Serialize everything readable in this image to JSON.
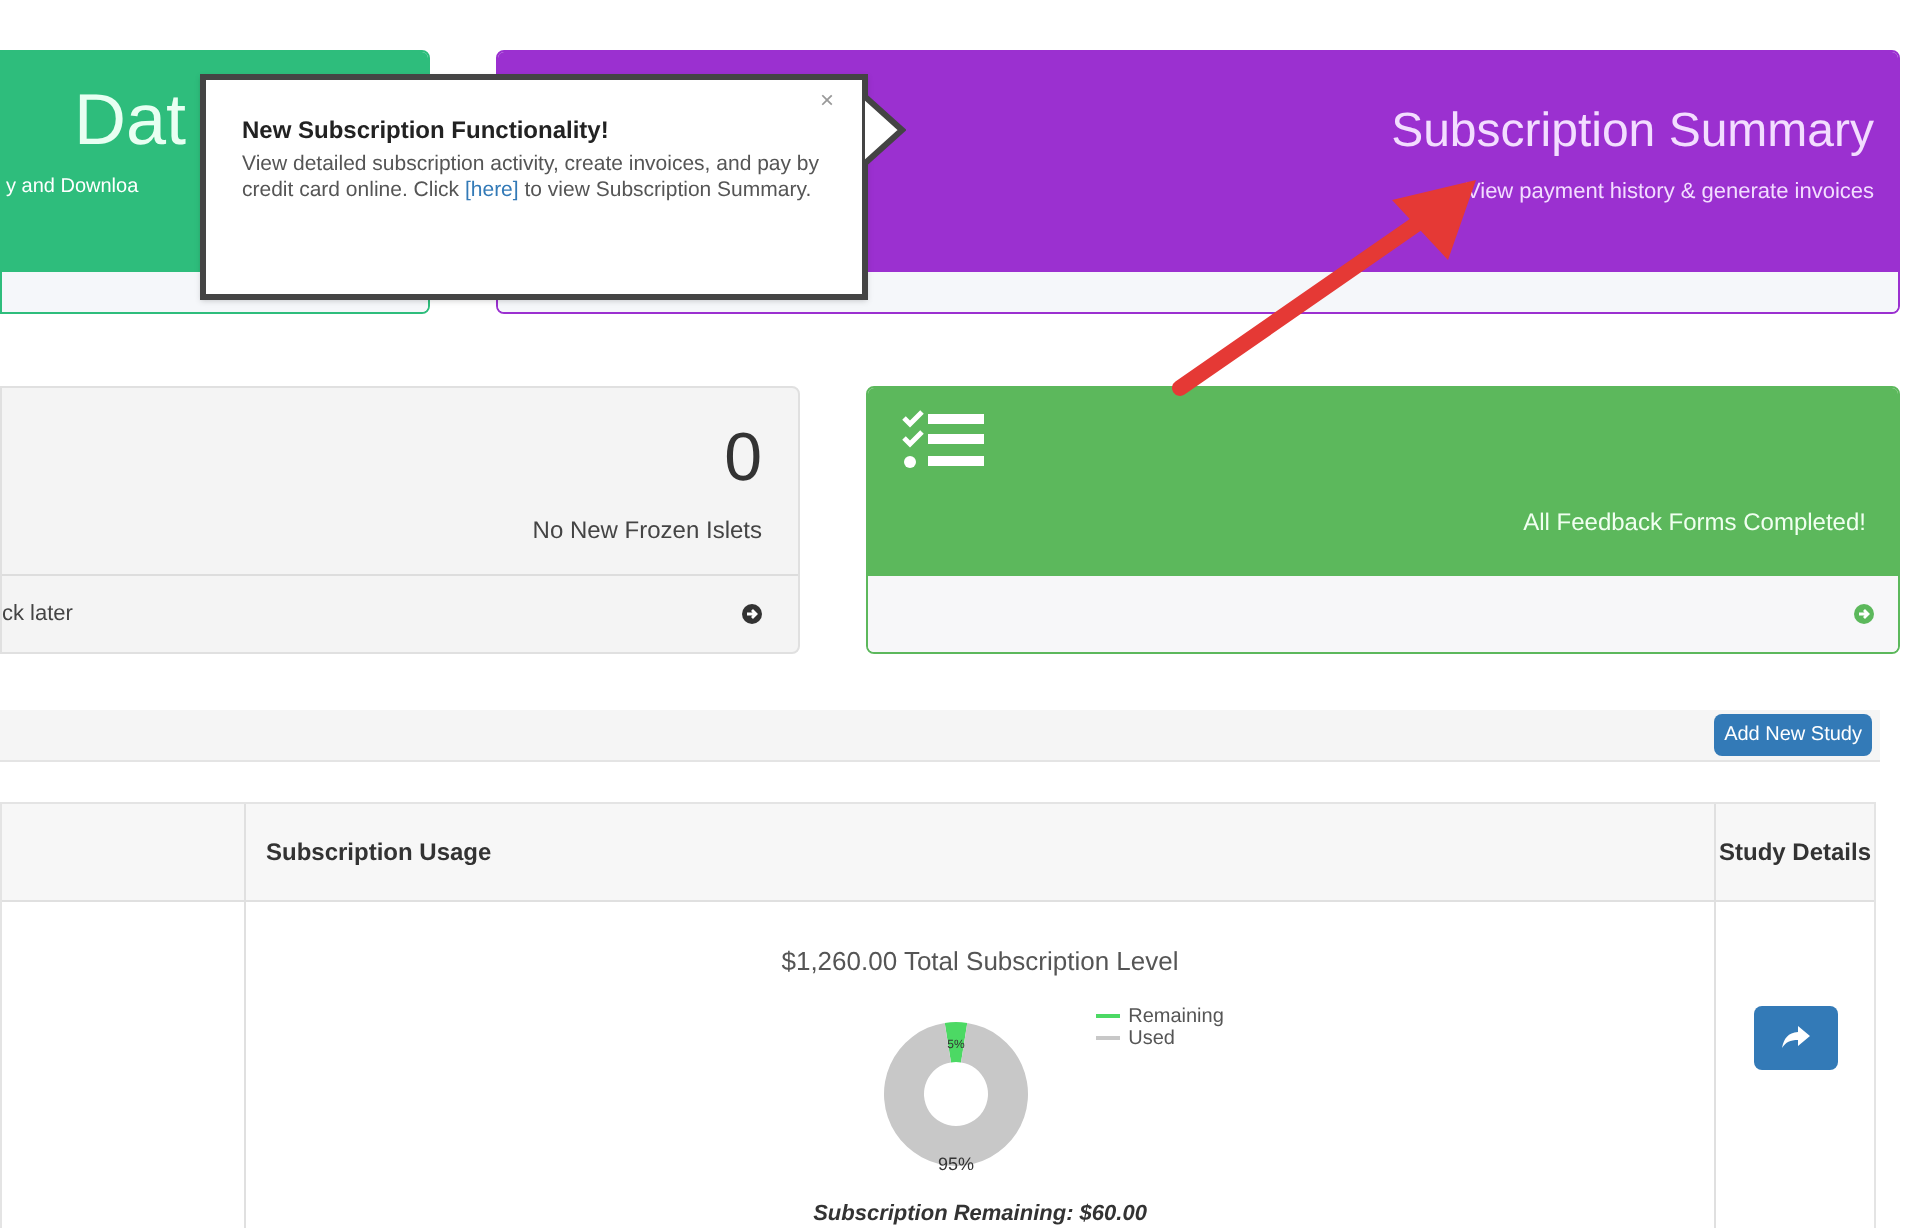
{
  "data_card": {
    "title": "Dat",
    "subtitle": "y and Downloa"
  },
  "subscription_card": {
    "title": "Subscription Summary",
    "subtitle": "View payment history & generate invoices"
  },
  "popover": {
    "title": "New Subscription Functionality!",
    "text_before": "View detailed subscription activity, create invoices, and pay by credit card online. Click",
    "link": "[here]",
    "text_after": "to view Subscription Summary.",
    "close": "×"
  },
  "islets_card": {
    "count": "0",
    "label": "No New Frozen Islets",
    "footer": "ck later"
  },
  "feedback_card": {
    "label": "All Feedback Forms Completed!"
  },
  "studies": {
    "add_button": "Add New Study",
    "columns": [
      "Subscription Usage",
      "Study Details"
    ],
    "total": "$1,260.00 Total Subscription Level",
    "chart_data": {
      "type": "donut",
      "categories": [
        "Remaining",
        "Used"
      ],
      "values": [
        5,
        95
      ],
      "value_labels": [
        "5%",
        "95%"
      ]
    },
    "legend": [
      {
        "color": "#4cd964"
      },
      {
        "color": "#c8c8c8"
      }
    ],
    "remaining": "Subscription Remaining: $60.00"
  }
}
